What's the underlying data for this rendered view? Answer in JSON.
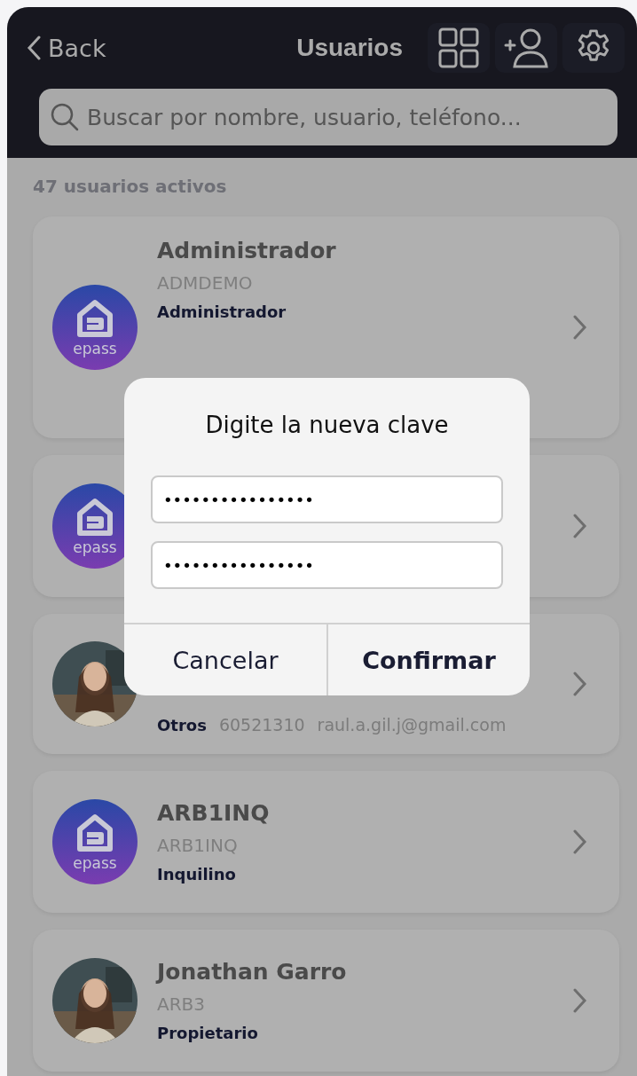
{
  "header": {
    "back_label": "Back",
    "title": "Usuarios"
  },
  "search": {
    "placeholder": "Buscar por nombre, usuario, teléfono..."
  },
  "count": "47 usuarios activos",
  "users": [
    {
      "kind": "logo",
      "logo_text": "epass",
      "name": "Administrador",
      "username": "ADMDEMO",
      "role": "Administrador"
    },
    {
      "kind": "logo",
      "logo_text": "epass"
    },
    {
      "kind": "picture",
      "role": "Otros",
      "phone": "60521310",
      "email": "raul.a.gil.j@gmail.com"
    },
    {
      "kind": "logo",
      "logo_text": "epass",
      "name": "ARB1INQ",
      "username": "ARB1INQ",
      "role": "Inquilino"
    },
    {
      "kind": "picture",
      "name": "Jonathan Garro",
      "username": "ARB3",
      "role": "Propietario"
    }
  ],
  "dialog": {
    "title": "Digite la nueva clave",
    "fields": [
      {
        "value": "••••••••••••••••"
      },
      {
        "value": "••••••••••••••••"
      }
    ],
    "buttons": [
      {
        "label": "Cancelar",
        "kind": "cancel"
      },
      {
        "label": "Confirmar",
        "kind": "confirm"
      }
    ]
  }
}
